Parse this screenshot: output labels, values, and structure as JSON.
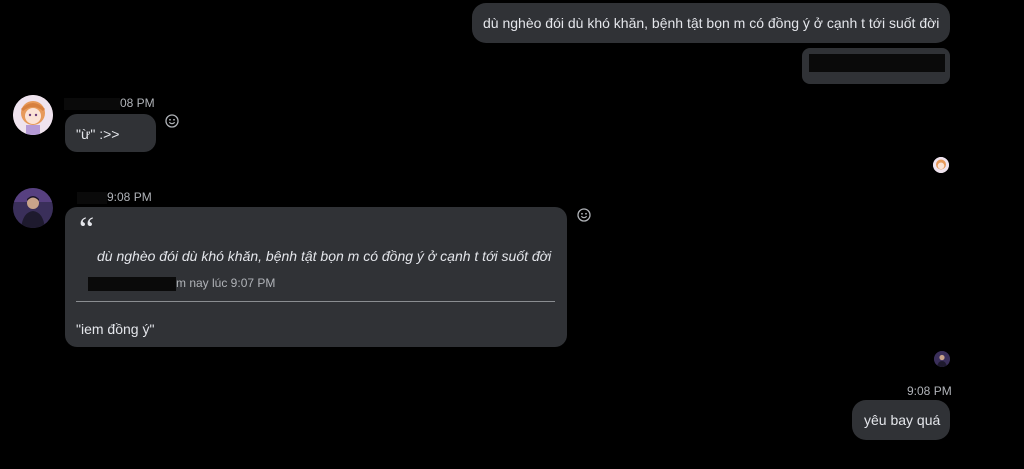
{
  "colors": {
    "background": "#000000",
    "bubble": "#303236",
    "text": "#e4e6eb",
    "meta_text": "#b0b3b8",
    "divider": "#8a8d91"
  },
  "messages": {
    "out_1": {
      "text": "dù nghèo đói dù khó khăn, bệnh tật bọn m có đồng ý ở cạnh t tới suốt đời"
    },
    "in_1": {
      "time": "08 PM",
      "text": "\"ừ\" :>>",
      "react_icon": "smiley-face-icon"
    },
    "in_2": {
      "time": "9:08 PM",
      "quote_mark": "“",
      "quoted_text": "dù nghèo đói dù khó khăn, bệnh tật bọn m có đồng ý ở cạnh t tới suốt đời",
      "quote_meta": "m nay lúc 9:07 PM",
      "reply_text": "\"iem đồng ý\"",
      "react_icon": "smiley-face-icon"
    },
    "out_2": {
      "time": "9:08 PM",
      "text": "yêu bay quá"
    }
  }
}
